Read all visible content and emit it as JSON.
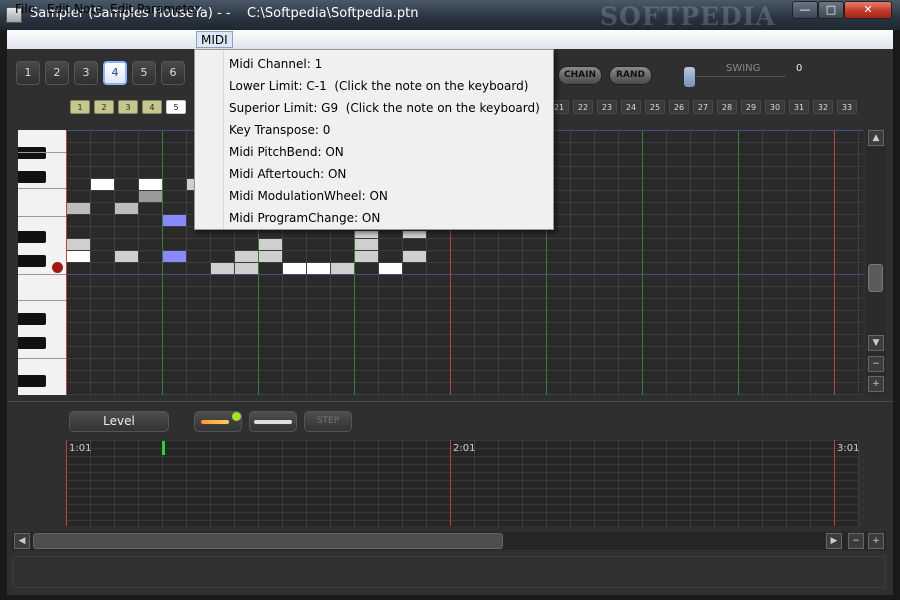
{
  "window": {
    "title": "Sampler (Samples HouseYa) - -    C:\\Softpedia\\Softpedia.ptn",
    "watermark": "SOFTPEDIA",
    "buttons": {
      "minimize": "—",
      "maximize": "□",
      "close": "✕"
    }
  },
  "menubar": {
    "items": [
      {
        "label": "File"
      },
      {
        "label": "Edit Note"
      },
      {
        "label": "Edit Parameter"
      },
      {
        "label": "MIDI"
      }
    ]
  },
  "midi_menu": {
    "items": [
      "Midi Channel: 1",
      "Lower Limit: C-1  (Click the note on the keyboard)",
      "Superior Limit: G9  (Click the note on the keyboard)",
      "Key Transpose: 0",
      "Midi PitchBend: ON",
      "Midi Aftertouch: ON",
      "Midi ModulationWheel: ON",
      "Midi ProgramChange: ON"
    ]
  },
  "patterns": [
    "1",
    "2",
    "3",
    "4",
    "5",
    "6"
  ],
  "selected_pattern": "4",
  "steps_left": [
    "1",
    "2",
    "3",
    "4",
    "5"
  ],
  "steps_right": [
    "21",
    "22",
    "23",
    "24",
    "25",
    "26",
    "27",
    "28",
    "29",
    "30",
    "31",
    "32",
    "33"
  ],
  "toolbar": {
    "chain": "CHAIN",
    "rand": "RAND",
    "swing_label": "SWING",
    "swing_value": "0"
  },
  "bottom": {
    "param": "Level",
    "step": "STEP"
  },
  "timeline": {
    "markers": [
      "1:01",
      "2:01",
      "3:01"
    ]
  },
  "scroll": {
    "up": "▲",
    "down": "▼",
    "left": "◀",
    "right": "▶",
    "minus": "−",
    "plus": "+"
  },
  "colors": {
    "accent": "#8888ff",
    "note": "#ffffff",
    "note_dim": "#cfcfcf",
    "bar_red": "#c04040",
    "beat_green": "#3c7a3c"
  }
}
